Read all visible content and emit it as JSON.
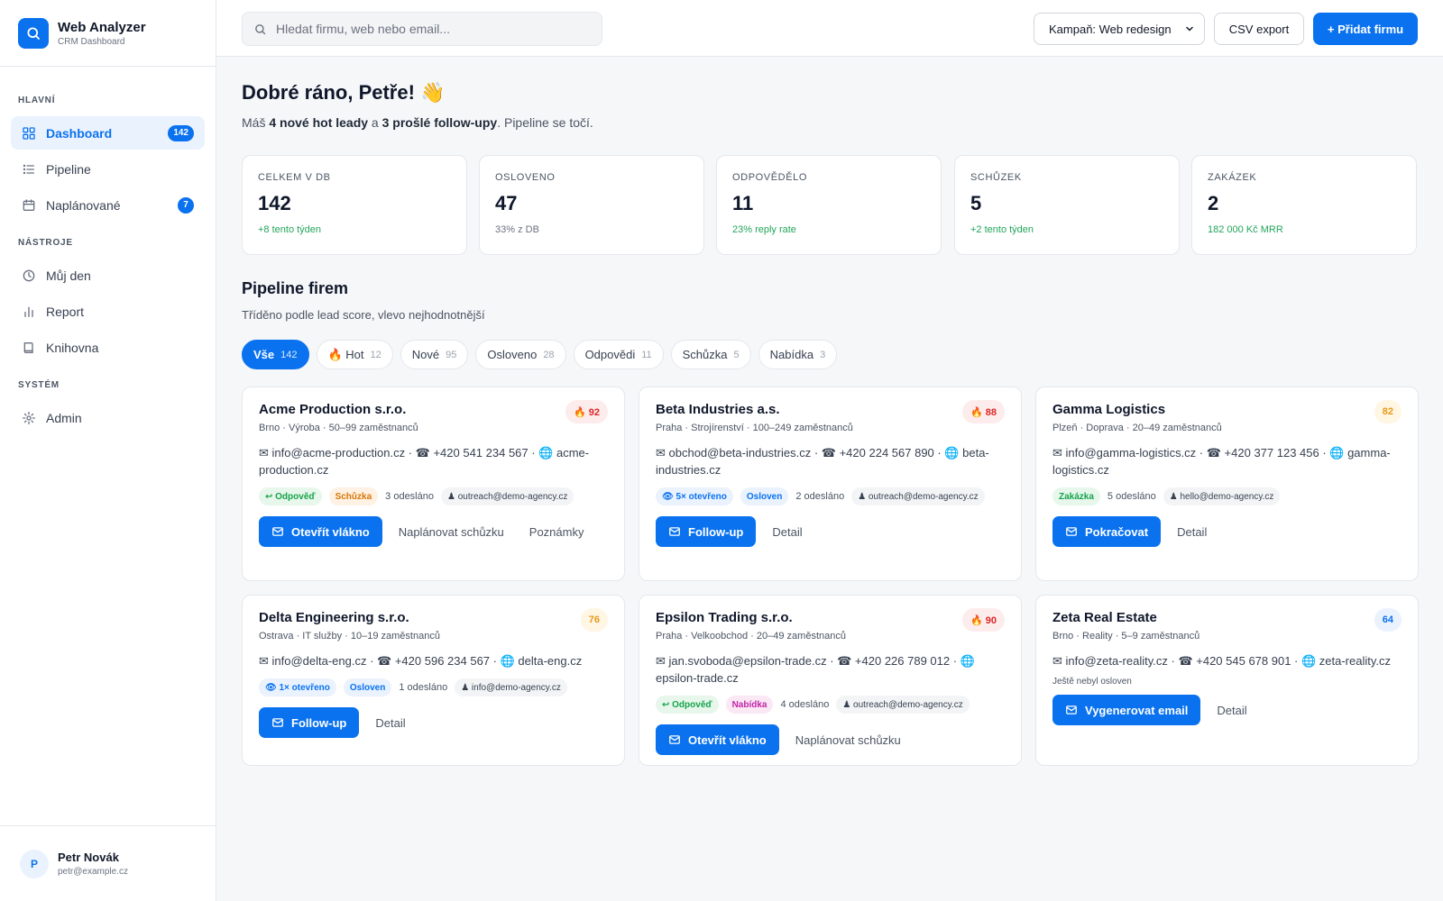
{
  "colors": {
    "accent": "#0a72ef",
    "hot": "#dc2626",
    "warm": "#e79a18",
    "success": "#22a55a"
  },
  "brand": {
    "title": "Web Analyzer",
    "subtitle": "CRM Dashboard"
  },
  "sidebar": {
    "sections": [
      "HLAVNÍ",
      "NÁSTROJE",
      "SYSTÉM"
    ],
    "items": [
      {
        "label": "Dashboard",
        "icon": "grid-icon",
        "badge": "142"
      },
      {
        "label": "Pipeline",
        "icon": "list-icon"
      },
      {
        "label": "Naplánované",
        "icon": "calendar-icon",
        "badge": "7"
      },
      {
        "label": "Můj den",
        "icon": "clock-icon"
      },
      {
        "label": "Report",
        "icon": "bar-chart-icon"
      },
      {
        "label": "Knihovna",
        "icon": "book-icon"
      },
      {
        "label": "Admin",
        "icon": "gear-icon"
      }
    ],
    "user": {
      "initial": "P",
      "name": "Petr Novák",
      "email": "petr@example.cz"
    }
  },
  "header": {
    "search_placeholder": "Hledat firmu, web nebo email...",
    "campaign_select": "Kampaň: Web redesign",
    "csv_export": "CSV export",
    "add_company": "+ Přidat firmu"
  },
  "greeting": {
    "title": "Dobré ráno, Petře! 👋",
    "sub_prefix": "Máš ",
    "sub_hot": "4 nové hot leady",
    "sub_mid": " a ",
    "sub_follow": "3 prošlé follow-upy",
    "sub_suffix": ". Pipeline se točí."
  },
  "stats": [
    {
      "label": "CELKEM V DB",
      "value": "142",
      "note": "+8 tento týden"
    },
    {
      "label": "OSLOVENO",
      "value": "47",
      "note": "33% z DB"
    },
    {
      "label": "ODPOVĚDĚLO",
      "value": "11",
      "note": "23% reply rate"
    },
    {
      "label": "SCHŮZEK",
      "value": "5",
      "note": "+2 tento týden"
    },
    {
      "label": "ZAKÁZEK",
      "value": "2",
      "note": "182 000 Kč MRR"
    }
  ],
  "pipeline": {
    "title": "Pipeline firem",
    "subtitle": "Tříděno podle lead score, vlevo nejhodnotnější",
    "filters": [
      {
        "label": "Vše",
        "count": "142"
      },
      {
        "label": "🔥 Hot",
        "count": "12"
      },
      {
        "label": "Nové",
        "count": "95"
      },
      {
        "label": "Osloveno",
        "count": "28"
      },
      {
        "label": "Odpovědi",
        "count": "11"
      },
      {
        "label": "Schůzka",
        "count": "5"
      },
      {
        "label": "Nabídka",
        "count": "3"
      }
    ],
    "cards": [
      {
        "name": "Acme Production s.r.o.",
        "meta": "Brno · Výroba · 50–99 zaměstnanců",
        "score": "🔥 92",
        "contact": "✉ info@acme-production.cz · ☎ +420 541 234 567 · 🌐 acme-production.cz",
        "tags": [
          "↩ Odpověď",
          "Schůzka"
        ],
        "sent": "3 odesláno",
        "sender": "♟ outreach@demo-agency.cz",
        "primary": "Otevřít vlákno",
        "secondary": [
          "Naplánovat schůzku",
          "Poznámky"
        ]
      },
      {
        "name": "Beta Industries a.s.",
        "meta": "Praha · Strojírenství · 100–249 zaměstnanců",
        "score": "🔥 88",
        "contact": "✉ obchod@beta-industries.cz · ☎ +420 224 567 890 · 🌐 beta-industries.cz",
        "tags": [
          "👁 5× otevřeno",
          "Osloven"
        ],
        "sent": "2 odesláno",
        "sender": "♟ outreach@demo-agency.cz",
        "primary": "Follow-up",
        "secondary": [
          "Detail"
        ]
      },
      {
        "name": "Gamma Logistics",
        "meta": "Plzeň · Doprava · 20–49 zaměstnanců",
        "score": "82",
        "contact": "✉ info@gamma-logistics.cz · ☎ +420 377 123 456 · 🌐 gamma-logistics.cz",
        "tags": [
          "Zakázka"
        ],
        "sent": "5 odesláno",
        "sender": "♟ hello@demo-agency.cz",
        "primary": "Pokračovat",
        "secondary": [
          "Detail"
        ]
      },
      {
        "name": "Delta Engineering s.r.o.",
        "meta": "Ostrava · IT služby · 10–19 zaměstnanců",
        "score": "76",
        "contact": "✉ info@delta-eng.cz · ☎ +420 596 234 567 · 🌐 delta-eng.cz",
        "tags": [
          "👁 1× otevřeno",
          "Osloven"
        ],
        "sent": "1 odesláno",
        "sender": "♟ info@demo-agency.cz",
        "primary": "Follow-up",
        "secondary": [
          "Detail"
        ]
      },
      {
        "name": "Epsilon Trading s.r.o.",
        "meta": "Praha · Velkoobchod · 20–49 zaměstnanců",
        "score": "🔥 90",
        "contact": "✉ jan.svoboda@epsilon-trade.cz · ☎ +420 226 789 012 · 🌐 epsilon-trade.cz",
        "tags": [
          "↩ Odpověď",
          "Nabídka"
        ],
        "sent": "4 odesláno",
        "sender": "♟ outreach@demo-agency.cz",
        "primary": "Otevřít vlákno",
        "secondary": [
          "Naplánovat schůzku"
        ]
      },
      {
        "name": "Zeta Real Estate",
        "meta": "Brno · Reality · 5–9 zaměstnanců",
        "score": "64",
        "contact": "✉ info@zeta-reality.cz · ☎ +420 545 678 901 · 🌐 zeta-reality.cz",
        "note": "Ještě nebyl osloven",
        "primary": "Vygenerovat email",
        "secondary": [
          "Detail"
        ]
      }
    ]
  }
}
